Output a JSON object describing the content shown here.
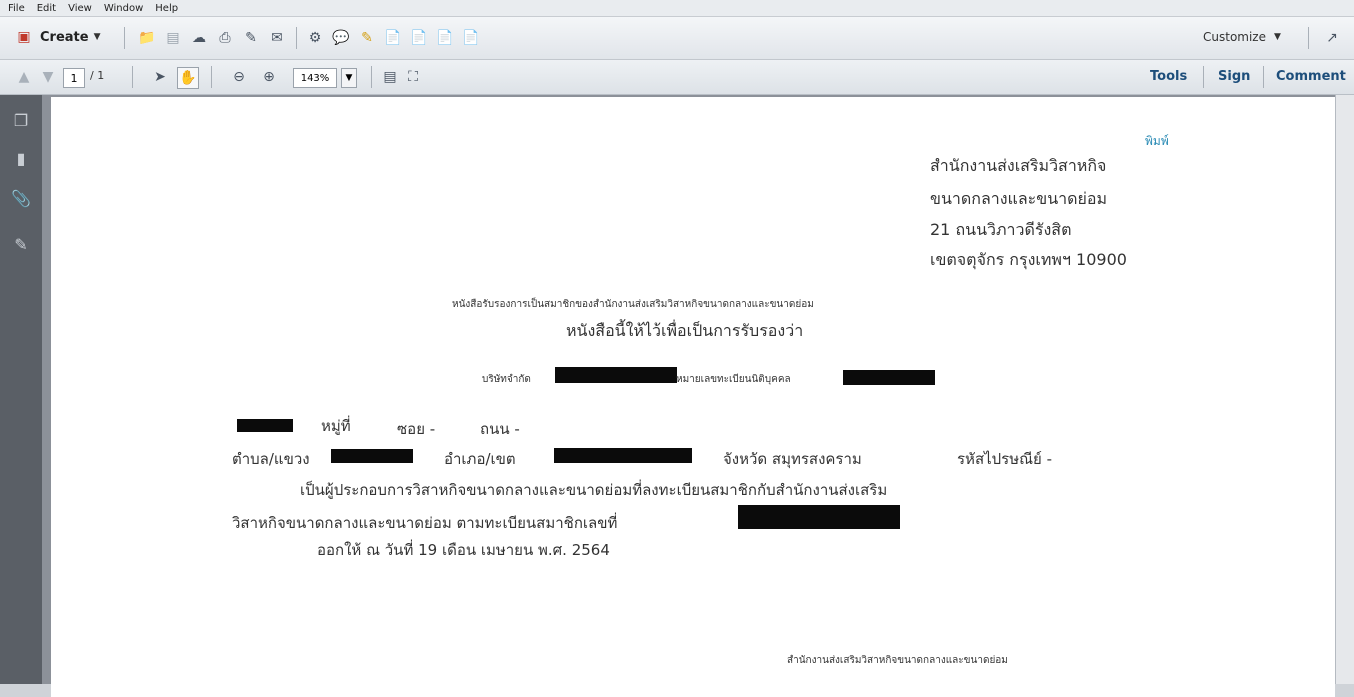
{
  "menu": [
    "File",
    "Edit",
    "View",
    "Window",
    "Help"
  ],
  "toolbar": {
    "create_label": "Create",
    "customize_label": "Customize"
  },
  "nav": {
    "page_current": "1",
    "page_total": "/ 1",
    "zoom": "143%"
  },
  "right_tabs": [
    "Tools",
    "Sign",
    "Comment"
  ],
  "document": {
    "print_link": "พิมพ์",
    "address": [
      "สำนักงานส่งเสริมวิสาหกิจ",
      "ขนาดกลางและขนาดย่อม",
      "21 ถนนวิภาวดีรังสิต",
      "เขตจตุจักร กรุงเทพฯ 10900"
    ],
    "cert_heading": "หนังสือรับรองการเป็นสมาชิกของสำนักงานส่งเสริมวิสาหกิจขนาดกลางและขนาดย่อม",
    "cert_subheading": "หนังสือนี้ให้ไว้เพื่อเป็นการรับรองว่า",
    "company_label": "บริษัทจำกัด",
    "registration_label": "หมายเลขทะเบียนนิติบุคคล",
    "line_moo": "หมู่ที่",
    "line_soi": "ซอย -",
    "line_road": "ถนน -",
    "line_tambon": "ตำบล/แขวง",
    "line_amphoe": "อำเภอ/เขต",
    "line_province": "จังหวัด สมุทรสงคราม",
    "line_postcode": "รหัสไปรษณีย์ -",
    "body_1": "เป็นผู้ประกอบการวิสาหกิจขนาดกลางและขนาดย่อมที่ลงทะเบียนสมาชิกกับสำนักงานส่งเสริม",
    "body_2": "วิสาหกิจขนาดกลางและขนาดย่อม ตามทะเบียนสมาชิกเลขที่",
    "issued": "ออกให้ ณ วันที่ 19 เดือน เมษายน พ.ศ. 2564",
    "footer_org": "สำนักงานส่งเสริมวิสาหกิจขนาดกลางและขนาดย่อม"
  }
}
